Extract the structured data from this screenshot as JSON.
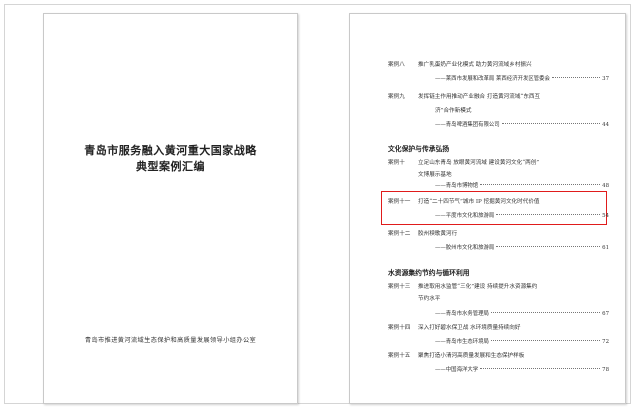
{
  "cover": {
    "title_line1": "青岛市服务融入黄河重大国家战略",
    "title_line2": "典型案例汇编",
    "issuer": "青岛市推进黄河流域生态保护和高质量发展领导小组办公室"
  },
  "toc": {
    "entries_top": [
      {
        "label": "案例八",
        "title_lines": [
          "推广乳蛋奶产业化模式 助力黄河流域乡村振兴"
        ],
        "org": "——莱西市发展和改革局 莱西经济开发区管委会",
        "page": "37"
      },
      {
        "label": "案例九",
        "title_lines": [
          "发挥链主作用推动产业融合 打造黄河流域“东西互",
          "济”合作新模式"
        ],
        "org": "——青岛啤酒集团有限公司",
        "page": "44"
      }
    ],
    "section_culture": "文化保护与传承弘扬",
    "entries_culture": [
      {
        "label": "案例十",
        "title_lines": [
          "立足山东青岛 放眼黄河流域 建设黄河文化“两创”",
          "文博展示基地"
        ],
        "org": "——青岛市博物馆",
        "page": "48"
      },
      {
        "label": "案例十一",
        "title_lines": [
          "打造“二十四节气”城市 IP 挖掘黄河文化时代价值"
        ],
        "org": "——平度市文化和旅游局",
        "page": "54"
      },
      {
        "label": "案例十二",
        "title_lines": [
          "胶州秧歌黄河行"
        ],
        "org": "——胶州市文化和旅游局",
        "page": "61"
      }
    ],
    "section_water": "水资源集约节约与循环利用",
    "entries_water": [
      {
        "label": "案例十三",
        "title_lines": [
          "推进取用水监管“三化”建设 持续提升水资源集约",
          "节约水平"
        ],
        "org": "——青岛市水务管理局",
        "page": "67"
      },
      {
        "label": "案例十四",
        "title_lines": [
          "深入打好碧水保卫战 水环境质量持续向好"
        ],
        "org": "——青岛市生态环境局",
        "page": "72"
      },
      {
        "label": "案例十五",
        "title_lines": [
          "聚焦打造小清河高质量发展和生态保护样板"
        ],
        "org": "——中国海洋大学",
        "page": "78"
      }
    ],
    "highlight_color": "#e01b1b"
  }
}
